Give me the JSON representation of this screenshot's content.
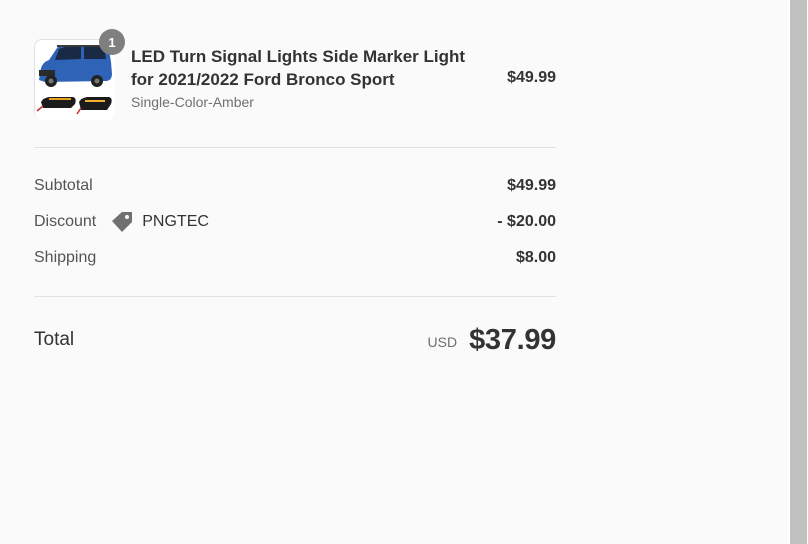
{
  "product": {
    "quantity": "1",
    "title": "LED Turn Signal Lights Side Marker Light for 2021/2022 Ford Bronco Sport",
    "variant": "Single-Color-Amber",
    "price": "$49.99"
  },
  "summary": {
    "subtotal_label": "Subtotal",
    "subtotal_value": "$49.99",
    "discount_label": "Discount",
    "discount_code": "PNGTEC",
    "discount_value": "- $20.00",
    "shipping_label": "Shipping",
    "shipping_value": "$8.00"
  },
  "total": {
    "label": "Total",
    "currency": "USD",
    "amount": "$37.99"
  },
  "icons": {
    "discount": "tag-icon",
    "product_image": "product-thumbnail"
  },
  "colors": {
    "background": "#fafafa",
    "text": "#333333",
    "muted": "#707070",
    "badge": "#7f7f7f",
    "divider": "#e1e1e1"
  }
}
